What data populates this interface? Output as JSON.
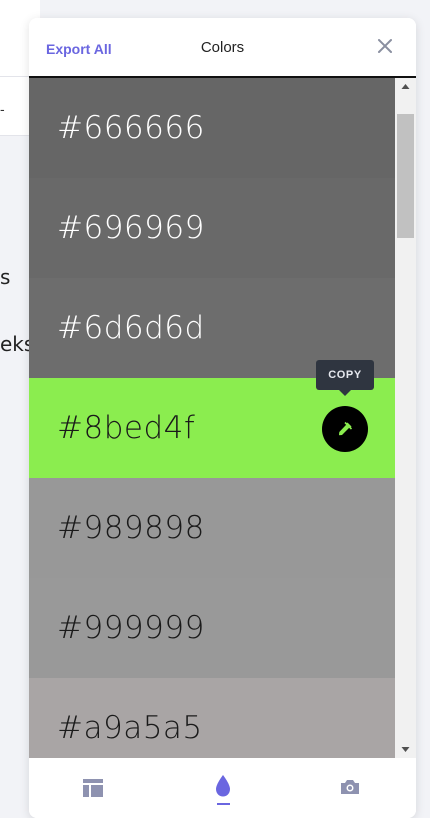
{
  "background": {
    "partial_texts": [
      "s",
      "eks"
    ]
  },
  "header": {
    "export_label": "Export All",
    "title": "Colors"
  },
  "colors": [
    {
      "hex": "#666666",
      "text_color": "#ffffff"
    },
    {
      "hex": "#696969",
      "text_color": "#ffffff"
    },
    {
      "hex": "#6d6d6d",
      "text_color": "#ffffff"
    },
    {
      "hex": "#8bed4f",
      "text_color": "#1a1a1a"
    },
    {
      "hex": "#989898",
      "text_color": "#1a1a1a"
    },
    {
      "hex": "#999999",
      "text_color": "#1a1a1a"
    },
    {
      "hex": "#a9a5a5",
      "text_color": "#1a1a1a"
    }
  ],
  "tooltip": {
    "label": "COPY"
  },
  "accent_color": "#6a66e0",
  "nav": {
    "items": [
      {
        "icon": "layout-icon",
        "active": false
      },
      {
        "icon": "drop-icon",
        "active": true
      },
      {
        "icon": "camera-icon",
        "active": false
      }
    ]
  }
}
